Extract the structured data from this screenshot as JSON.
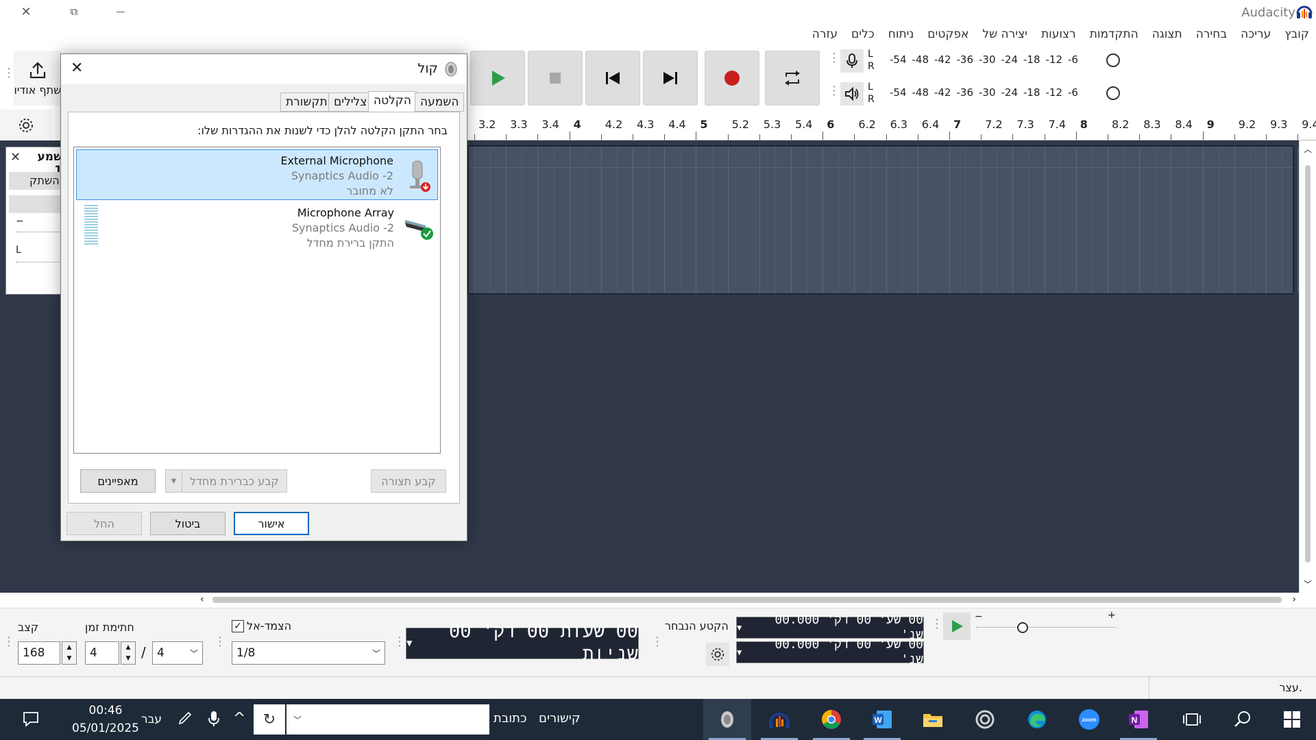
{
  "window": {
    "title": "Audacity",
    "close": "✕",
    "restore": "⧉",
    "minimize": "—"
  },
  "menu": [
    "קובץ",
    "עריכה",
    "בחירה",
    "תצוגה",
    "התקדמות",
    "רצועות",
    "יצירה של",
    "אפקטים",
    "ניתוח",
    "כלים",
    "עזרה"
  ],
  "share_audio": "שתף אודיו",
  "meters": {
    "scale": [
      "-54",
      "-48",
      "-42",
      "-36",
      "-30",
      "-24",
      "-18",
      "-12",
      "-6"
    ],
    "L": "L",
    "R": "R"
  },
  "ruler": {
    "ticks": [
      "3.2",
      "3.3",
      "3.4",
      "4",
      "4.2",
      "4.3",
      "4.4",
      "5",
      "5.2",
      "5.3",
      "5.4",
      "6",
      "6.2",
      "6.3",
      "6.4",
      "7",
      "7.2",
      "7.3",
      "7.4",
      "8",
      "8.2",
      "8.3",
      "8.4",
      "9",
      "9.2",
      "9.3",
      "9.4"
    ],
    "bold": [
      "4",
      "5",
      "6",
      "7",
      "8",
      "9"
    ]
  },
  "track": {
    "name": "שמע 1",
    "mute_label": "השתק",
    "close": "✕",
    "gain_minus": "−",
    "pan_left": "L"
  },
  "dialog": {
    "title": "קול",
    "close": "✕",
    "tabs": [
      "השמעה",
      "הקלטה",
      "צלילים",
      "תקשורת"
    ],
    "active_tab": "הקלטה",
    "instruction": "בחר התקן הקלטה להלן כדי לשנות את ההגדרות שלו:",
    "devices": [
      {
        "name": "External Microphone",
        "driver": "Synaptics Audio -2",
        "status": "לא מחובר"
      },
      {
        "name": "Microphone Array",
        "driver": "Synaptics Audio -2",
        "status": "התקן ברירת מחדל"
      }
    ],
    "configure_button": "קבע תצורה",
    "set_default_button": "קבע כברירת מחדל",
    "properties_button": "מאפיינים",
    "ok_button": "אישור",
    "cancel_button": "ביטול",
    "apply_button": "החל"
  },
  "bottom": {
    "tempo_label": "קצב",
    "tempo_value": "168",
    "time_sig_label": "חתימת זמן",
    "time_sig_num": "4",
    "time_sig_slash": "/",
    "time_sig_den": "4",
    "snap_label": "הצמד-אל",
    "snap_value": "1/8",
    "big_time": "00 שעות 00 דק' 00 שניות",
    "selection_label": "הקטע הנבחר",
    "sel_start": "00 שע' 00 דק' 00.000 שנ'",
    "sel_end": "00 שע' 00 דק' 00.000 שנ'",
    "speed_minus": "−",
    "speed_plus": "+"
  },
  "status": {
    "text": "עצר."
  },
  "taskbar": {
    "time": "00:46",
    "date": "05/01/2025",
    "lang": "עבר",
    "address_label": "כתובת",
    "links_label": "קישורים",
    "address_value": ""
  },
  "colors": {
    "track_bg": "#30384a",
    "clip_bg": "#485266",
    "record_red": "#c81e1e",
    "play_green": "#2e9e4a",
    "selection_blue": "#cce8ff",
    "taskbar_bg": "#1e2a38"
  }
}
